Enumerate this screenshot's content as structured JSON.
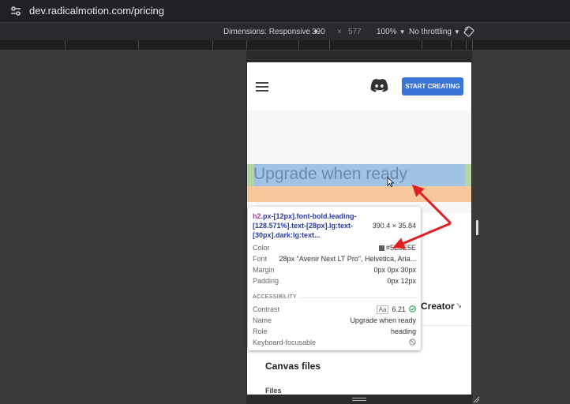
{
  "browser": {
    "url": "dev.radicalmotion.com/pricing"
  },
  "devtools": {
    "dimensions_label": "Dimensions: Responsive",
    "width": "390",
    "times": "×",
    "height": "577",
    "zoom": "100%",
    "throttling": "No throttling"
  },
  "page": {
    "cta_label": "START CREATING",
    "heading": "Upgrade when ready",
    "creator_label": "Creator",
    "creator_arrow": "↘",
    "canvas_files": "Canvas files",
    "files_label": "Files",
    "accent_color": "#3b74d9"
  },
  "tooltip": {
    "tag": "h2",
    "selector_rest": ".px-[12px].font-bold.leading-[128.571%].text-[28px].lg:text-[30px].dark:lg:text...",
    "size": "390.4 × 35.84",
    "color_label": "Color",
    "color_value": "#5E5E5E",
    "font_label": "Font",
    "font_value": "28px \"Avenir Next LT Pro\", Helvetica, Aria...",
    "margin_label": "Margin",
    "margin_value": "0px 0px 30px",
    "padding_label": "Padding",
    "padding_value": "0px 12px",
    "accessibility_label": "ACCESSIBILITY",
    "contrast_label": "Contrast",
    "contrast_badge": "Aa",
    "contrast_value": "6.21",
    "name_label": "Name",
    "name_value": "Upgrade when ready",
    "role_label": "Role",
    "role_value": "heading",
    "keyboard_label": "Keyboard-focusable"
  },
  "annotation_color": "#e02020"
}
